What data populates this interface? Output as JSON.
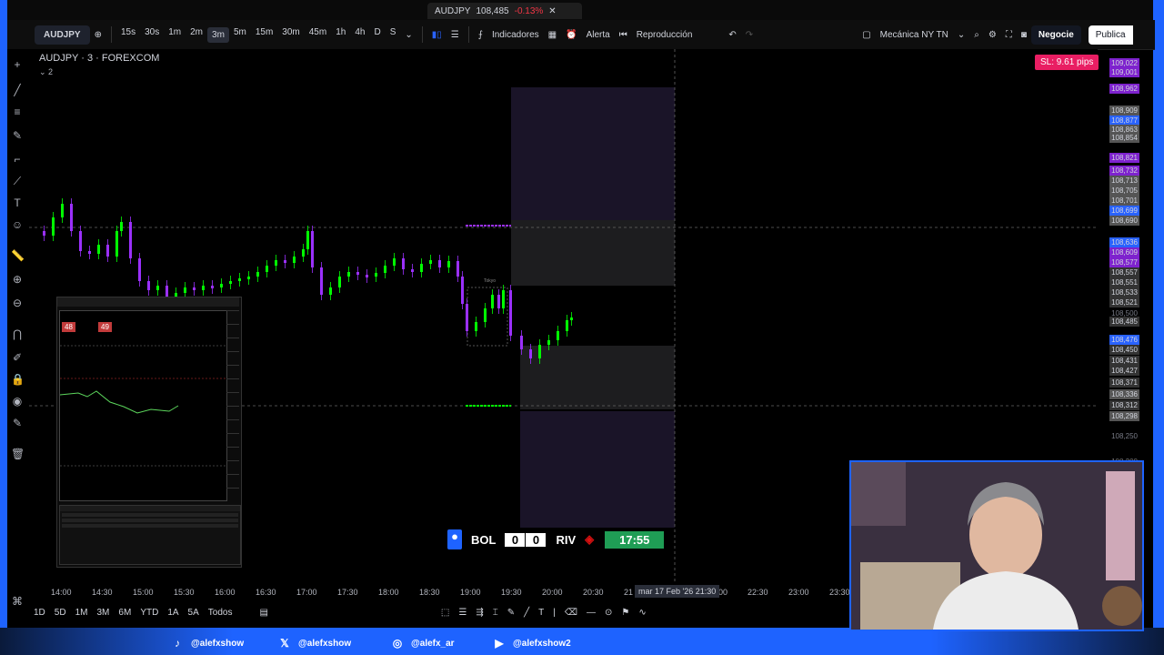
{
  "window_tab": {
    "symbol": "AUDJPY",
    "price": "108,485",
    "change": "-0.13%"
  },
  "toolbar": {
    "symbol": "AUDJPY",
    "intervals": [
      "15s",
      "30s",
      "1m",
      "2m",
      "3m",
      "5m",
      "15m",
      "30m",
      "45m",
      "1h",
      "4h",
      "D",
      "S"
    ],
    "active_interval": "3m",
    "indicators": "Indicadores",
    "alert": "Alerta",
    "replay": "Reproducción",
    "layout_name": "Mecánica NY TN",
    "trade_button": "Negocie",
    "publish_button": "Publica"
  },
  "chart": {
    "title": "AUDJPY · 3 · FOREXCOM",
    "collapse_count": "2",
    "sl_badge": "SL: 9.61 pips",
    "session_label": "Tokyo",
    "colors": {
      "bull": "#00ff00",
      "bear": "#9b30ff",
      "zone": "#1a1428"
    }
  },
  "price_scale": [
    {
      "v": "109,022",
      "bg": "#7e22ce"
    },
    {
      "v": "109,001",
      "bg": "#7e22ce"
    },
    {
      "v": "108,962",
      "bg": "#7e22ce"
    },
    {
      "v": "108,909",
      "bg": "#555"
    },
    {
      "v": "108,877",
      "bg": "#2962ff"
    },
    {
      "v": "108,863",
      "bg": "#555"
    },
    {
      "v": "108,854",
      "bg": "#555"
    },
    {
      "v": "108,821",
      "bg": "#7e22ce"
    },
    {
      "v": "108,732",
      "bg": "#7e22ce"
    },
    {
      "v": "108,713",
      "bg": "#555"
    },
    {
      "v": "108,705",
      "bg": "#555"
    },
    {
      "v": "108,701",
      "bg": "#555"
    },
    {
      "v": "108,699",
      "bg": "#2962ff"
    },
    {
      "v": "108,690",
      "bg": "#555"
    },
    {
      "v": "108,636",
      "bg": "#2962ff"
    },
    {
      "v": "108,609",
      "bg": "#7e22ce"
    },
    {
      "v": "108,577",
      "bg": "#7e22ce"
    },
    {
      "v": "108,557",
      "bg": "#333"
    },
    {
      "v": "108,551",
      "bg": "#333"
    },
    {
      "v": "108,533",
      "bg": "#333"
    },
    {
      "v": "108,521",
      "bg": "#333"
    },
    {
      "v": "108,500",
      "bg": ""
    },
    {
      "v": "108,485",
      "bg": "#333"
    },
    {
      "v": "108,476",
      "bg": "#2962ff"
    },
    {
      "v": "108,450",
      "bg": "#333"
    },
    {
      "v": "108,431",
      "bg": "#333"
    },
    {
      "v": "108,427",
      "bg": "#333"
    },
    {
      "v": "108,371",
      "bg": "#333"
    },
    {
      "v": "108,336",
      "bg": "#555"
    },
    {
      "v": "108,312",
      "bg": "#333"
    },
    {
      "v": "108,298",
      "bg": "#555"
    },
    {
      "v": "108,250",
      "bg": ""
    },
    {
      "v": "108,200",
      "bg": ""
    }
  ],
  "time_scale": [
    "14:00",
    "14:30",
    "15:00",
    "15:30",
    "16:00",
    "16:30",
    "17:00",
    "17:30",
    "18:00",
    "18:30",
    "19:00",
    "19:30",
    "20:00",
    "20:30",
    "21",
    "00",
    "22:30",
    "23:00",
    "23:30"
  ],
  "crosshair_time": "mar 17 Feb '26   21:30",
  "bottom_bar": {
    "ranges": [
      "1D",
      "5D",
      "1M",
      "3M",
      "6M",
      "YTD",
      "1A",
      "5A",
      "Todos"
    ]
  },
  "inset": {
    "badge_sell": "48",
    "badge_buy": "49"
  },
  "scoreboard": {
    "home": "BOL",
    "home_score": "0",
    "away_score": "0",
    "away": "RIV",
    "clock": "17:55"
  },
  "socials": [
    {
      "icon": "tiktok-icon",
      "handle": "@alefxshow"
    },
    {
      "icon": "x-icon",
      "handle": "@alefxshow"
    },
    {
      "icon": "instagram-icon",
      "handle": "@alefx_ar"
    },
    {
      "icon": "youtube-icon",
      "handle": "@alefxshow2"
    }
  ]
}
